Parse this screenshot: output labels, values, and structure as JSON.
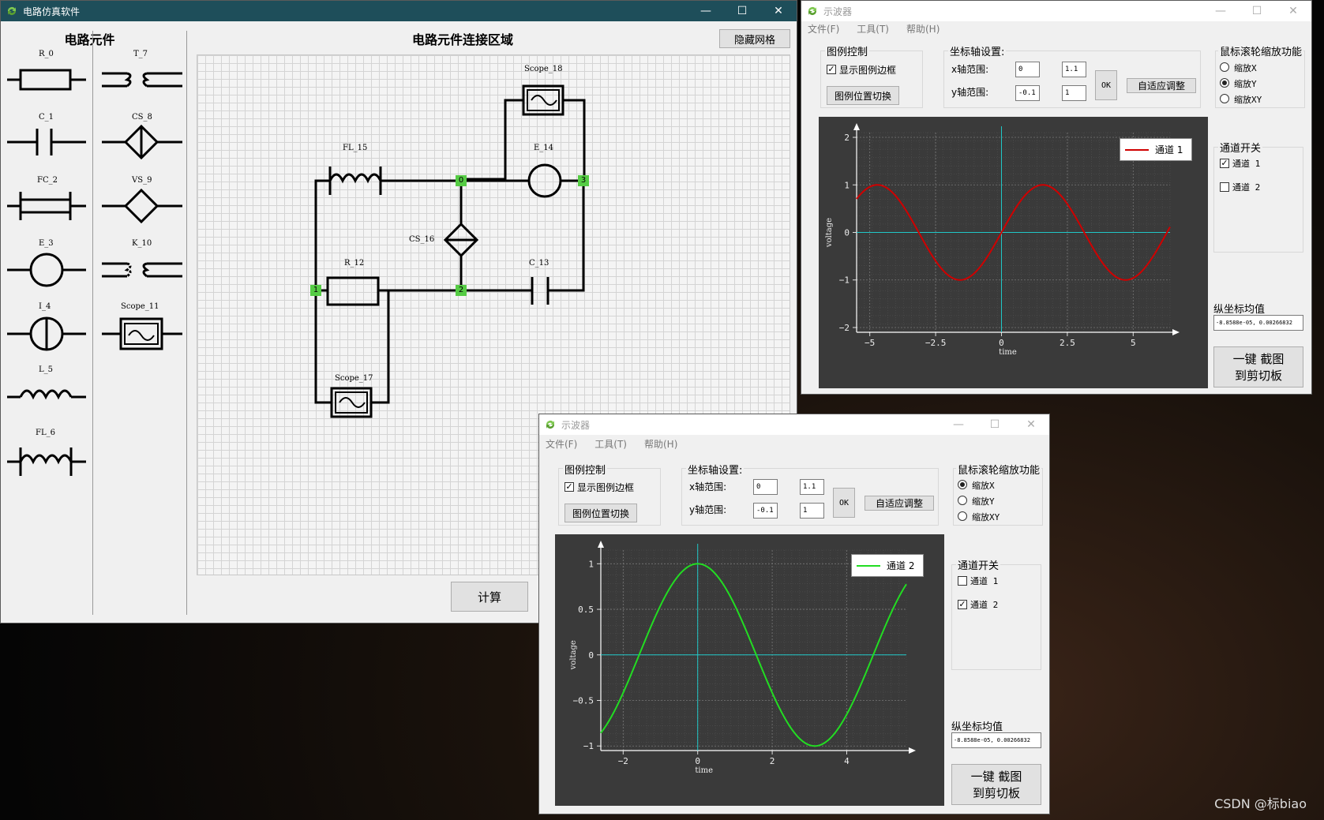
{
  "main_window": {
    "title": "电路仿真软件",
    "panel_title": "电路元件",
    "canvas_title": "电路元件连接区域",
    "hide_grid_button": "隐藏网格",
    "calc_button": "计算",
    "palette": [
      {
        "label": "R_0"
      },
      {
        "label": "T_7"
      },
      {
        "label": "C_1"
      },
      {
        "label": "CS_8"
      },
      {
        "label": "FC_2"
      },
      {
        "label": "VS_9"
      },
      {
        "label": "E_3"
      },
      {
        "label": "K_10"
      },
      {
        "label": "I_4"
      },
      {
        "label": "Scope_11"
      },
      {
        "label": "L_5"
      },
      {
        "label": "FL_6"
      }
    ],
    "circuit": {
      "scope18": "Scope_18",
      "fl15": "FL_15",
      "e14": "E_14",
      "cs16": "CS_16",
      "r12": "R_12",
      "c13": "C_13",
      "scope17": "Scope_17",
      "node0": "0",
      "node1": "1",
      "node2": "2",
      "node3": "3"
    }
  },
  "scope1": {
    "title": "示波器",
    "menu": [
      "文件(F)",
      "工具(T)",
      "帮助(H)"
    ],
    "legend_group": "图例控制",
    "show_legend_border": "显示图例边框",
    "legend_pos_button": "图例位置切换",
    "axis_group": "坐标轴设置:",
    "x_range_label": "x轴范围:",
    "y_range_label": "y轴范围:",
    "x_min": "0",
    "x_max": "1.1",
    "y_min": "-0.1",
    "y_max": "1",
    "ok_button": "OK",
    "auto_button": "自适应调整",
    "wheel_group": "鼠标滚轮缩放功能",
    "zoom_x": "缩放X",
    "zoom_y": "缩放Y",
    "zoom_xy": "缩放XY",
    "selected_zoom": "Y",
    "channel_group": "通道开关",
    "ch1": "通道 1",
    "ch2": "通道 2",
    "ch1_checked": true,
    "ch2_checked": false,
    "mean_label": "纵坐标均值",
    "mean_value": "-8.8588e-05, 0.00266832",
    "screenshot_button_1": "一键 截图",
    "screenshot_button_2": "到剪切板",
    "legend_text": "通道 1",
    "line_color": "#d00000"
  },
  "scope2": {
    "title": "示波器",
    "menu": [
      "文件(F)",
      "工具(T)",
      "帮助(H)"
    ],
    "legend_group": "图例控制",
    "show_legend_border": "显示图例边框",
    "legend_pos_button": "图例位置切换",
    "axis_group": "坐标轴设置:",
    "x_range_label": "x轴范围:",
    "y_range_label": "y轴范围:",
    "x_min": "0",
    "x_max": "1.1",
    "y_min": "-0.1",
    "y_max": "1",
    "ok_button": "OK",
    "auto_button": "自适应调整",
    "wheel_group": "鼠标滚轮缩放功能",
    "zoom_x": "缩放X",
    "zoom_y": "缩放Y",
    "zoom_xy": "缩放XY",
    "selected_zoom": "X",
    "channel_group": "通道开关",
    "ch1": "通道 1",
    "ch2": "通道 2",
    "ch1_checked": false,
    "ch2_checked": true,
    "mean_label": "纵坐标均值",
    "mean_value": "-8.8588e-05, 0.00266832",
    "screenshot_button_1": "一键 截图",
    "screenshot_button_2": "到剪切板",
    "legend_text": "通道 2",
    "line_color": "#22dd22"
  },
  "chart_data": [
    {
      "type": "line",
      "xlabel": "time",
      "ylabel": "voltage",
      "xlim": [
        -5.5,
        6.4
      ],
      "ylim": [
        -2.1,
        2.1
      ],
      "xticks": [
        "-5",
        "-2.5",
        "0",
        "2.5",
        "5"
      ],
      "yticks": [
        "2",
        "1",
        "0",
        "-1",
        "-2"
      ],
      "series": [
        {
          "name": "通道 1",
          "function": "sin(x)",
          "x_range": [
            -5.5,
            6.4
          ],
          "color": "#d00000"
        }
      ],
      "grid": true,
      "legend": "top-right"
    },
    {
      "type": "line",
      "xlabel": "time",
      "ylabel": "voltage",
      "xlim": [
        -2.6,
        5.6
      ],
      "ylim": [
        -1.05,
        1.15
      ],
      "xticks": [
        "-2",
        "0",
        "2",
        "4"
      ],
      "yticks": [
        "1",
        "0.5",
        "0",
        "-0.5",
        "-1"
      ],
      "series": [
        {
          "name": "通道 2",
          "function": "cos(x)",
          "x_range": [
            -2.6,
            5.6
          ],
          "color": "#22dd22"
        }
      ],
      "grid": true,
      "legend": "top-right"
    }
  ],
  "watermark": "CSDN @标biao"
}
